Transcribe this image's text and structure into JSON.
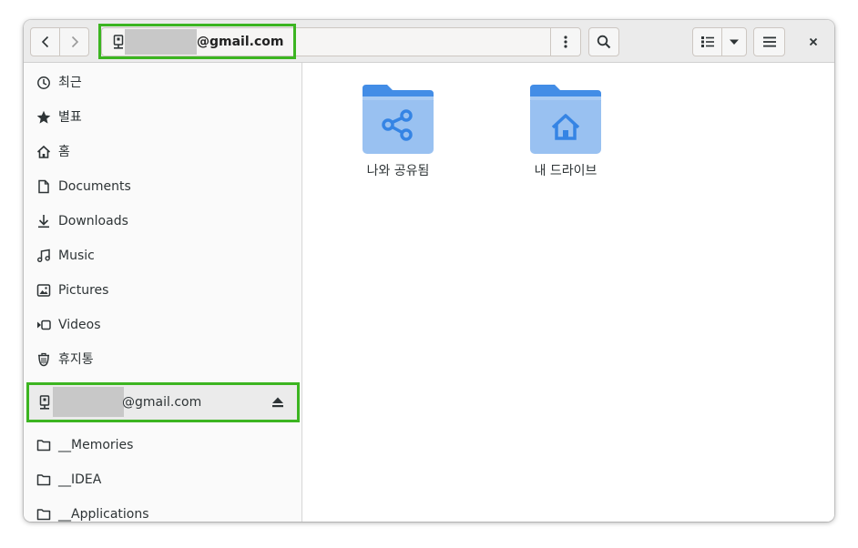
{
  "header": {
    "path_label": "@gmail.com",
    "buttons": {
      "back": "back",
      "forward": "forward"
    }
  },
  "sidebar": {
    "items": [
      {
        "label": "최근",
        "icon": "recent-icon"
      },
      {
        "label": "별표",
        "icon": "star-icon"
      },
      {
        "label": "홈",
        "icon": "home-icon"
      },
      {
        "label": "Documents",
        "icon": "document-icon"
      },
      {
        "label": "Downloads",
        "icon": "download-icon"
      },
      {
        "label": "Music",
        "icon": "music-icon"
      },
      {
        "label": "Pictures",
        "icon": "picture-icon"
      },
      {
        "label": "Videos",
        "icon": "video-icon"
      },
      {
        "label": "휴지통",
        "icon": "trash-icon"
      }
    ],
    "account": {
      "label": "@gmail.com",
      "icon": "network-drive-icon"
    },
    "bookmarks": [
      {
        "label": "__Memories",
        "icon": "folder-icon"
      },
      {
        "label": "__IDEA",
        "icon": "folder-icon"
      },
      {
        "label": "__Applications",
        "icon": "folder-icon"
      }
    ]
  },
  "main": {
    "files": [
      {
        "name": "나와 공유됨",
        "icon": "shared-folder-icon"
      },
      {
        "name": "내 드라이브",
        "icon": "home-folder-icon"
      }
    ]
  },
  "colors": {
    "highlight": "#3cb521",
    "folder_top": "#438de6",
    "folder_body": "#99c1f1"
  }
}
